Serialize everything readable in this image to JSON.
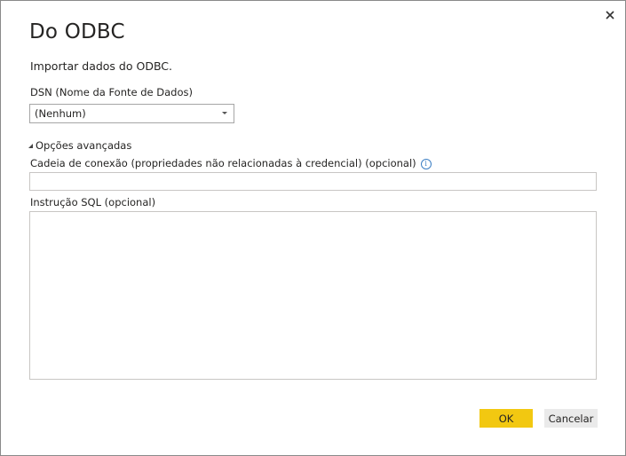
{
  "dialog": {
    "title": "Do ODBC",
    "subtitle": "Importar dados do ODBC.",
    "close_icon": "close-icon",
    "dsn": {
      "label": "DSN (Nome da Fonte de Dados)",
      "selected": "(Nenhum)"
    },
    "advanced": {
      "toggle_label": "Opções avançadas",
      "expanded": true,
      "connection_string_label": "Cadeia de conexão (propriedades não relacionadas à credencial) (opcional)",
      "connection_string_value": "",
      "info_icon": "info-icon",
      "info_glyph": "i",
      "sql_label": "Instrução SQL (opcional)",
      "sql_value": ""
    },
    "buttons": {
      "ok": "OK",
      "cancel": "Cancelar"
    },
    "colors": {
      "ok_button": "#f2c811",
      "cancel_button": "#eaeaea",
      "info_icon": "#3c7fc4"
    }
  }
}
